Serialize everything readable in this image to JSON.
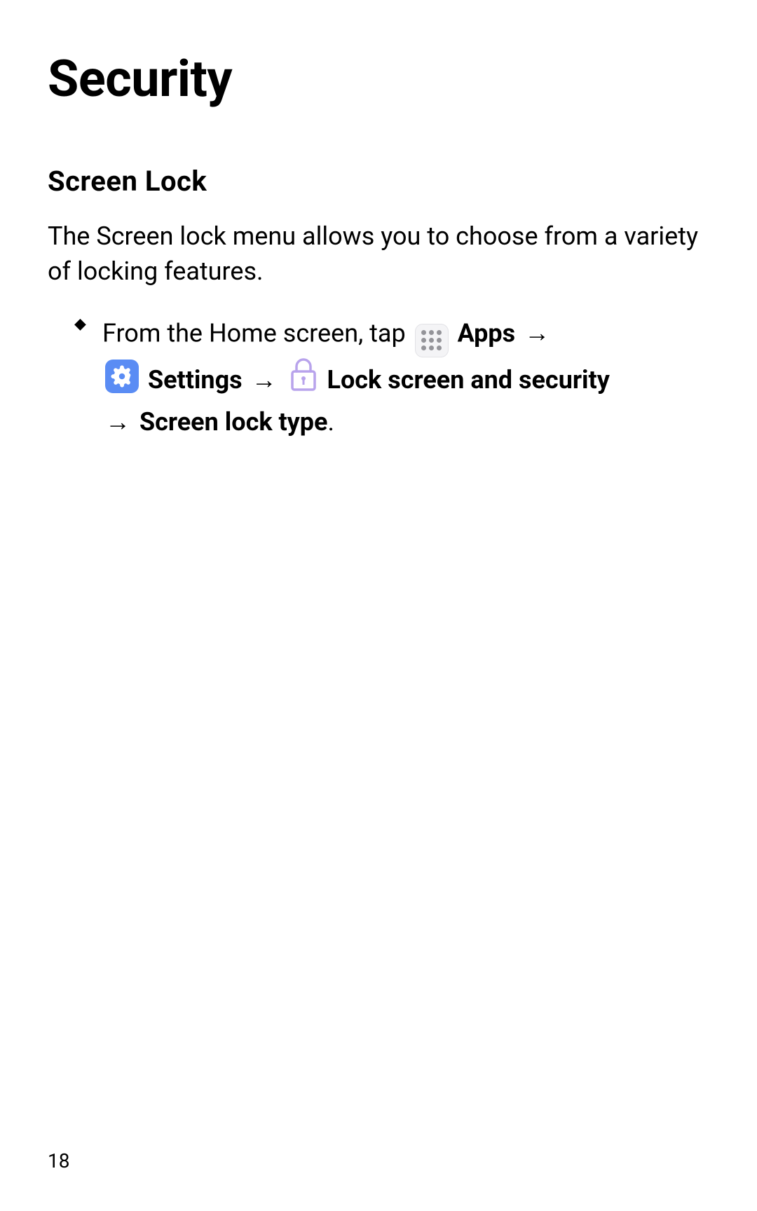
{
  "page": {
    "title": "Security",
    "section_heading": "Screen Lock",
    "intro": "The Screen lock menu allows you to choose from a variety of locking features.",
    "page_number": "18"
  },
  "instruction": {
    "prefix": "From the Home screen, tap ",
    "apps_label": "Apps",
    "arrow": "→",
    "settings_label": "Settings",
    "lock_label": "Lock screen and security",
    "screen_lock_type_label": "Screen lock type",
    "period": "."
  },
  "icons": {
    "apps": "apps-icon",
    "settings": "settings-icon",
    "lock": "lock-icon"
  }
}
